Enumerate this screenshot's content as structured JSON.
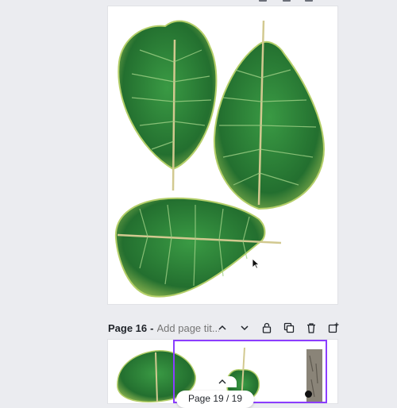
{
  "editor": {
    "current_page": {
      "label": "Page 16",
      "separator": "-",
      "title_placeholder": "Add page tit..."
    },
    "page_indicator": "Page 19 / 19",
    "colors": {
      "background": "#ebecf0",
      "selection": "#8b3dff",
      "leaf_dark": "#1f5f2a",
      "leaf_mid": "#2e8a3c",
      "leaf_light": "#a8c85a",
      "stem": "#c9b36a"
    },
    "header_icons": [
      "chevron-up-icon",
      "chevron-down-icon",
      "lock-icon",
      "duplicate-icon",
      "trash-icon",
      "add-page-icon"
    ],
    "page_content": [
      "fiddle-leaf-1",
      "fiddle-leaf-2",
      "fiddle-leaf-3"
    ]
  }
}
